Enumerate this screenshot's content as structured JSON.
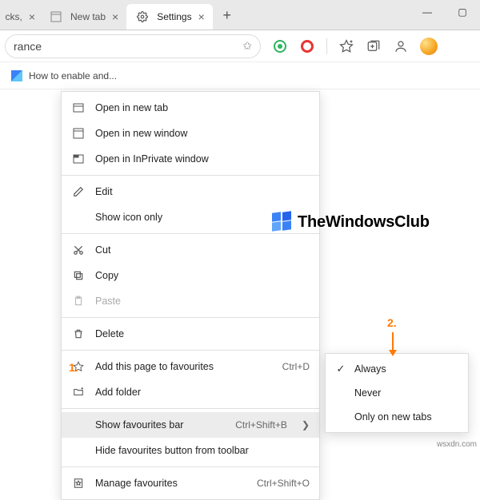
{
  "tabs": {
    "cut_close": "×",
    "newtab_label": "New tab",
    "settings_label": "Settings",
    "newtab_plus": "+"
  },
  "window": {
    "minimize": "—",
    "maximize": "▢"
  },
  "omnibox": {
    "text": "rance",
    "star": "✩"
  },
  "favbar": {
    "item0": "How to enable and..."
  },
  "ctx": {
    "open_new_tab": "Open in new tab",
    "open_new_window": "Open in new window",
    "open_inprivate": "Open in InPrivate window",
    "edit": "Edit",
    "show_icon_only": "Show icon only",
    "cut": "Cut",
    "copy": "Copy",
    "paste": "Paste",
    "delete": "Delete",
    "add_fav": "Add this page to favourites",
    "add_fav_accel": "Ctrl+D",
    "add_folder": "Add folder",
    "show_favbar": "Show favourites bar",
    "show_favbar_accel": "Ctrl+Shift+B",
    "hide_fav_btn": "Hide favourites button from toolbar",
    "manage_fav": "Manage favourites",
    "manage_fav_accel": "Ctrl+Shift+O"
  },
  "submenu": {
    "always": "Always",
    "never": "Never",
    "only_new": "Only on new tabs"
  },
  "annotations": {
    "one": "1.",
    "two": "2."
  },
  "branding": {
    "twc": "TheWindowsClub",
    "watermark": "wsxdn.com"
  }
}
